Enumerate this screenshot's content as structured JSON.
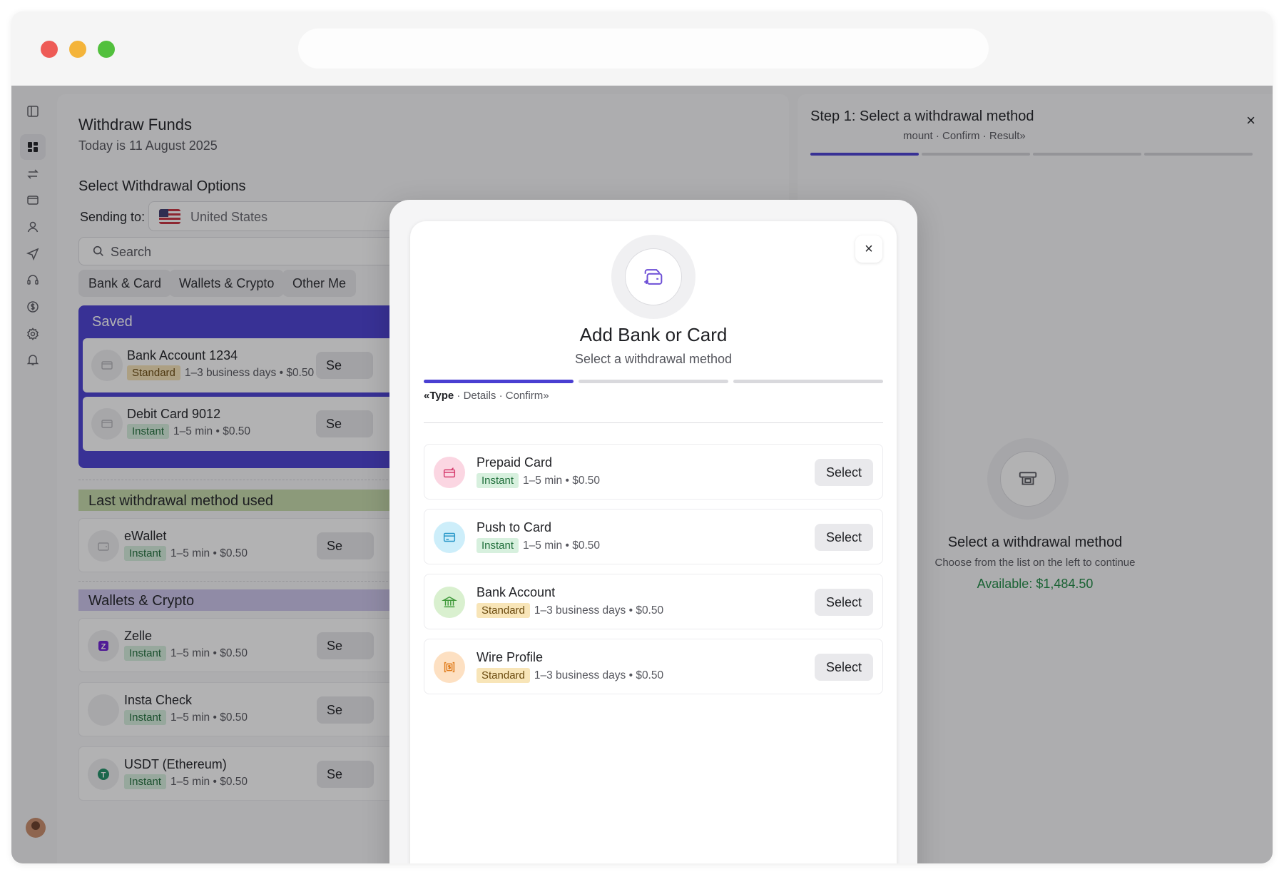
{
  "left_panel": {
    "title": "Withdraw Funds",
    "date": "Today is 11 August 2025",
    "section_title": "Select Withdrawal Options",
    "sending_label": "Sending to:",
    "country": "United States",
    "search_placeholder": "Search",
    "chips": [
      "Bank & Card",
      "Wallets & Crypto",
      "Other Me"
    ],
    "saved": {
      "header": "Saved",
      "items": [
        {
          "name": "Bank Account 1234",
          "badge": "Standard",
          "meta": "1–3 business days • $0.50",
          "button": "Se"
        },
        {
          "name": "Debit Card 9012",
          "badge": "Instant",
          "meta": "1–5 min • $0.50",
          "button": "Se"
        }
      ]
    },
    "last_used": {
      "header": "Last withdrawal method used",
      "items": [
        {
          "name": "eWallet",
          "badge": "Instant",
          "meta": "1–5 min • $0.50",
          "button": "Se"
        }
      ]
    },
    "wallets": {
      "header": "Wallets & Crypto",
      "items": [
        {
          "name": "Zelle",
          "badge": "Instant",
          "meta": "1–5 min • $0.50",
          "button": "Se"
        },
        {
          "name": "Insta Check",
          "badge": "Instant",
          "meta": "1–5 min • $0.50",
          "button": "Se"
        },
        {
          "name": "USDT (Ethereum)",
          "badge": "Instant",
          "meta": "1–5 min • $0.50",
          "button": "Se"
        }
      ]
    }
  },
  "right_panel": {
    "step_title": "Step 1: Select a withdrawal method",
    "crumbs": "mount · Confirm · Result»",
    "close": "×",
    "empty_title": "Select a withdrawal method",
    "empty_subtitle": "Choose from the list on the left to continue",
    "available": "Available: $1,484.50"
  },
  "modal": {
    "close": "×",
    "title": "Add Bank or Card",
    "subtitle": "Select a withdrawal method",
    "steps_current": "«Type",
    "steps_rest": " · Details · Confirm»",
    "options": [
      {
        "name": "Prepaid Card",
        "badge": "Instant",
        "meta": "1–5 min • $0.50",
        "button": "Select"
      },
      {
        "name": "Push to Card",
        "badge": "Instant",
        "meta": "1–5 min • $0.50",
        "button": "Select"
      },
      {
        "name": "Bank Account",
        "badge": "Standard",
        "meta": "1–3 business days • $0.50",
        "button": "Select"
      },
      {
        "name": "Wire Profile",
        "badge": "Standard",
        "meta": "1–3 business days • $0.50",
        "button": "Select"
      }
    ]
  },
  "colors": {
    "accent": "#4a3fd2",
    "saved_bg": "#4a3fd2",
    "last_used_bg": "#c6dcaa",
    "wallets_bg": "#cdc5ec",
    "available_text": "#1e8a44",
    "instant_badge": "#d7f0de",
    "standard_badge": "#f8e5b8"
  },
  "icons": {
    "rail": [
      "sidebar-toggle-icon",
      "dashboard-icon",
      "transfer-icon",
      "wallet-icon",
      "user-icon",
      "send-icon",
      "headset-icon",
      "dollar-icon",
      "settings-icon",
      "bell-icon"
    ]
  }
}
